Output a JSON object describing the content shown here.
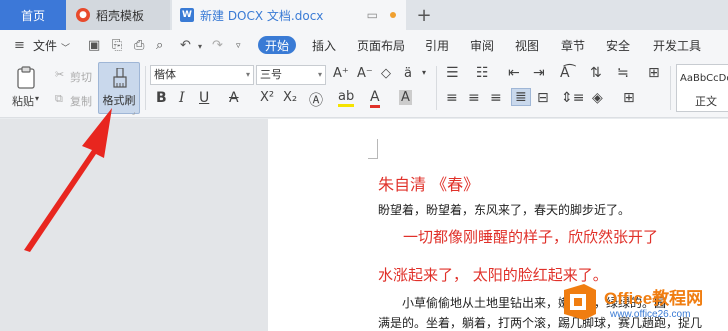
{
  "tabs": {
    "home": "首页",
    "template": "稻壳模板",
    "doc": "新建 DOCX 文档.docx",
    "add": "+"
  },
  "menu": {
    "file": "文件",
    "start": "开始",
    "items": [
      "插入",
      "页面布局",
      "引用",
      "审阅",
      "视图",
      "章节",
      "安全",
      "开发工具"
    ]
  },
  "ribbon": {
    "paste": "粘贴",
    "cut": "剪切",
    "copy": "复制",
    "format_painter": "格式刷",
    "font_name": "楷体",
    "font_size": "三号",
    "style_preview": "AaBbCcDd",
    "style_name": "正文"
  },
  "document": {
    "line1": "朱自清 《春》",
    "line2": "盼望着，盼望着，东风来了，春天的脚步近了。",
    "line3": "一切都像刚睡醒的样子，欣欣然张开了",
    "line4": "水涨起来了， 太阳的脸红起来了。",
    "line5": "小草偷偷地从土地里钻出来，嫩嫩的，绿绿的。园",
    "line6": "满是的。坐着，躺着，打两个滚，踢几脚球，赛几趟跑，捉几"
  },
  "watermark": {
    "title": "Office教程网",
    "url": "www.office26.com"
  },
  "colors": {
    "accent": "#3a7bd5",
    "doc_red": "#e0312a",
    "arrow": "#e8261f"
  }
}
